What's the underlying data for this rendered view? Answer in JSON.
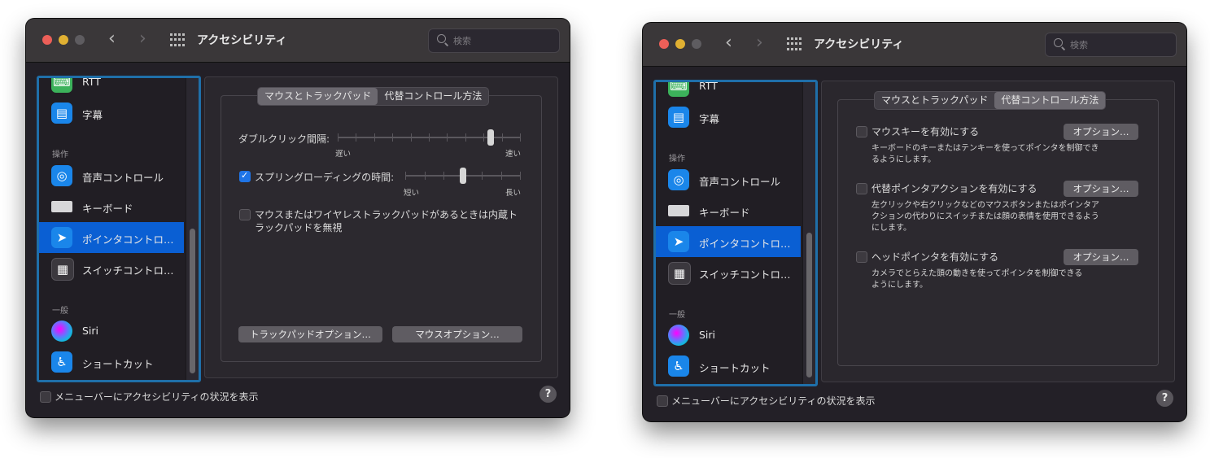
{
  "window": {
    "title": "アクセシビリティ",
    "search_placeholder": "検索",
    "nav_back": "‹",
    "nav_forward": "›"
  },
  "sidebar": {
    "items_top": [
      {
        "label": "RTT",
        "icon": "rtt-icon"
      },
      {
        "label": "字幕",
        "icon": "captions-icon"
      }
    ],
    "section_operation": "操作",
    "items_operation": [
      {
        "label": "音声コントロール",
        "icon": "voice-control-icon"
      },
      {
        "label": "キーボード",
        "icon": "keyboard-icon"
      },
      {
        "label": "ポインタコントロ…",
        "icon": "pointer-control-icon",
        "selected": true
      },
      {
        "label": "スイッチコントロ…",
        "icon": "switch-control-icon"
      }
    ],
    "section_general": "一般",
    "items_general": [
      {
        "label": "Siri",
        "icon": "siri-icon"
      },
      {
        "label": "ショートカット",
        "icon": "shortcut-icon"
      }
    ]
  },
  "tabs": {
    "mouse_trackpad": "マウスとトラックパッド",
    "alt_control": "代替コントロール方法"
  },
  "mouse_pane": {
    "double_click_label": "ダブルクリック間隔:",
    "double_click_slow": "遅い",
    "double_click_fast": "速い",
    "double_click_value": 0.85,
    "spring_loading_label": "スプリングローディングの時間:",
    "spring_loading_checked": true,
    "spring_short": "短い",
    "spring_long": "長い",
    "spring_value": 0.5,
    "ignore_trackpad_line1": "マウスまたはワイヤレストラックパッドがあるときは内蔵ト",
    "ignore_trackpad_line2": "ラックパッドを無視",
    "ignore_trackpad_checked": false,
    "trackpad_options_button": "トラックパッドオプション…",
    "mouse_options_button": "マウスオプション…"
  },
  "alt_pane": {
    "mouse_keys_label": "マウスキーを有効にする",
    "mouse_keys_desc_line1": "キーボードのキーまたはテンキーを使ってポインタを制御でき",
    "mouse_keys_desc_line2": "るようにします。",
    "alt_pointer_label": "代替ポインタアクションを有効にする",
    "alt_pointer_desc_line1": "左クリックや右クリックなどのマウスボタンまたはポインタア",
    "alt_pointer_desc_line2": "クションの代わりにスイッチまたは顔の表情を使用できるよう",
    "alt_pointer_desc_line3": "にします。",
    "head_pointer_label": "ヘッドポインタを有効にする",
    "head_pointer_desc_line1": "カメラでとらえた頭の動きを使ってポインタを制御できる",
    "head_pointer_desc_line2": "ようにします。",
    "options_button": "オプション…"
  },
  "footer": {
    "show_status_label": "メニューバーにアクセシビリティの状況を表示",
    "help": "?"
  },
  "colors": {
    "accent": "#0a5fd3",
    "sidebar_focus_ring": "#1f6fa9",
    "window_bg": "#232027"
  }
}
